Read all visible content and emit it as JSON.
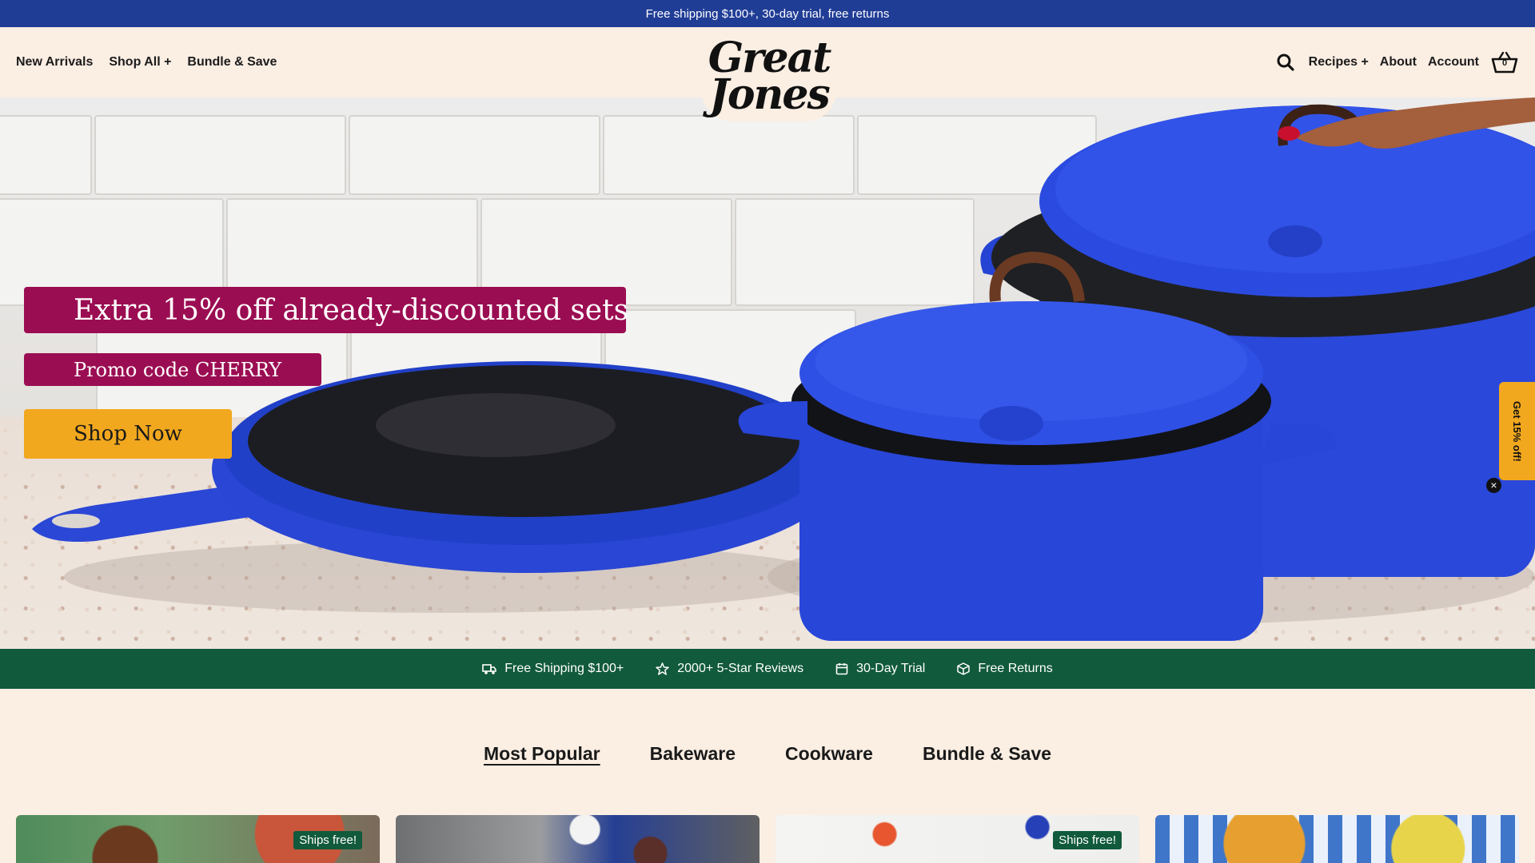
{
  "announcement": {
    "text": "Free shipping $100+, 30-day trial, free returns"
  },
  "header": {
    "left_nav": [
      {
        "label": "New Arrivals"
      },
      {
        "label": "Shop All +"
      },
      {
        "label": "Bundle & Save"
      }
    ],
    "logo": {
      "line1": "Great",
      "line2": "Jones"
    },
    "right_nav": [
      {
        "label": "Recipes +"
      },
      {
        "label": "About"
      },
      {
        "label": "Account"
      }
    ],
    "cart_count": "0",
    "icons": [
      "search-icon",
      "basket-icon"
    ]
  },
  "hero": {
    "headline": "Extra 15% off already-discounted sets",
    "promo_code": "Promo code CHERRY",
    "cta_label": "Shop Now"
  },
  "side_offer": {
    "label": "Get 15% off!",
    "close": "×"
  },
  "values": [
    {
      "icon": "truck-icon",
      "label": "Free Shipping $100+"
    },
    {
      "icon": "star-icon",
      "label": "2000+ 5-Star Reviews"
    },
    {
      "icon": "calendar-icon",
      "label": "30-Day Trial"
    },
    {
      "icon": "box-icon",
      "label": "Free Returns"
    }
  ],
  "tabs": [
    {
      "label": "Most Popular",
      "active": true
    },
    {
      "label": "Bakeware",
      "active": false
    },
    {
      "label": "Cookware",
      "active": false
    },
    {
      "label": "Bundle & Save",
      "active": false
    }
  ],
  "products": [
    {
      "badge": "Ships free!"
    },
    {
      "badge": ""
    },
    {
      "badge": "Ships free!"
    },
    {
      "badge": ""
    }
  ],
  "colors": {
    "announcement_bg": "#203d96",
    "page_bg": "#fbeee3",
    "promo_bg": "#9b0d52",
    "cta_bg": "#f2a81e",
    "values_bar_bg": "#115a3c",
    "cookware_blue": "#2b47d6"
  }
}
